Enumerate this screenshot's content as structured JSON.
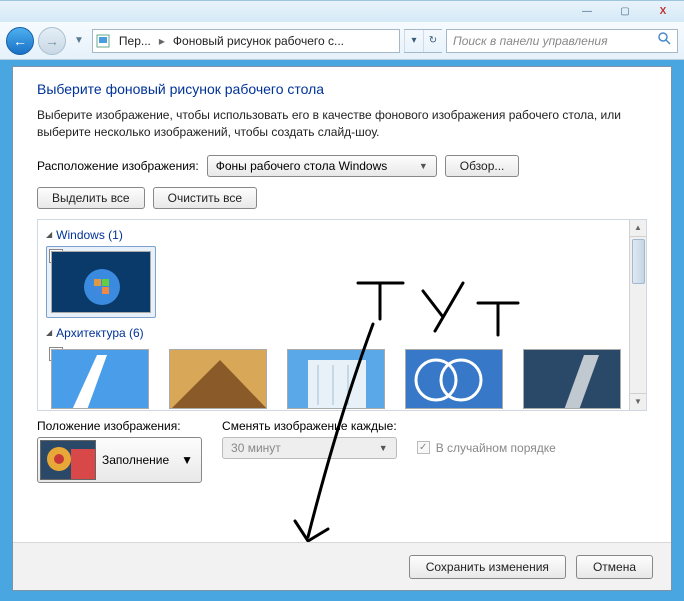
{
  "titlebar": {
    "min": "—",
    "max": "▢",
    "close": "X"
  },
  "nav": {
    "back": "←",
    "forward": "→",
    "crumb1": "Пер...",
    "crumb2": "Фоновый рисунок рабочего с...",
    "search_placeholder": "Поиск в панели управления"
  },
  "page": {
    "title": "Выберите фоновый рисунок рабочего стола",
    "desc": "Выберите изображение, чтобы использовать его в качестве фонового изображения рабочего стола, или выберите несколько изображений, чтобы создать слайд-шоу.",
    "location_label": "Расположение изображения:",
    "location_value": "Фоны рабочего стола Windows",
    "browse": "Обзор...",
    "select_all": "Выделить все",
    "clear_all": "Очистить все",
    "cat1": "Windows (1)",
    "cat2": "Архитектура (6)",
    "position_label": "Положение изображения:",
    "position_value": "Заполнение",
    "interval_label": "Сменять изображение каждые:",
    "interval_value": "30 минут",
    "shuffle": "В случайном порядке",
    "save": "Сохранить изменения",
    "cancel": "Отмена"
  }
}
